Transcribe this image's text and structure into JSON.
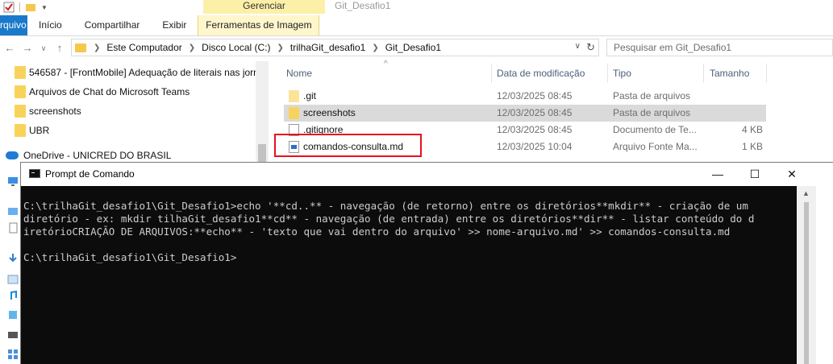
{
  "explorer": {
    "window_title": "Git_Desafio1",
    "contextual_group": "Gerenciar",
    "tabs": [
      "rquivo",
      "Início",
      "Compartilhar",
      "Exibir",
      "Ferramentas de Imagem"
    ],
    "breadcrumb": [
      "Este Computador",
      "Disco Local (C:)",
      "trilhaGit_desafio1",
      "Git_Desafio1"
    ],
    "search_placeholder": "Pesquisar em Git_Desafio1",
    "nav_items": [
      "546587 - [FrontMobile] Adequação de literais nas jorn",
      "Arquivos de Chat do Microsoft Teams",
      "screenshots",
      "UBR"
    ],
    "onedrive_label": "OneDrive - UNICRED DO BRASIL",
    "columns": {
      "name": "Nome",
      "date": "Data de modificação",
      "type": "Tipo",
      "size": "Tamanho"
    },
    "files": [
      {
        "name": ".git",
        "date": "12/03/2025 08:45",
        "type": "Pasta de arquivos",
        "size": "",
        "icon": "folder"
      },
      {
        "name": "screenshots",
        "date": "12/03/2025 08:45",
        "type": "Pasta de arquivos",
        "size": "",
        "icon": "folder",
        "selected": true
      },
      {
        "name": ".gitignore",
        "date": "12/03/2025 08:45",
        "type": "Documento de Te...",
        "size": "4 KB",
        "icon": "document"
      },
      {
        "name": "comandos-consulta.md",
        "date": "12/03/2025 10:04",
        "type": "Arquivo Fonte Ma...",
        "size": "1 KB",
        "icon": "markdown-file"
      }
    ]
  },
  "cmd": {
    "title": "Prompt de Comando",
    "lines": [
      "C:\\trilhaGit_desafio1\\Git_Desafio1>echo '**cd..** - navegação (de retorno) entre os diretórios**mkdir** - criação de um",
      "diretório - ex: mkdir tilhaGit_desafio1**cd** - navegação (de entrada) entre os diretórios**dir** - listar conteúdo do d",
      "iretórioCRIAÇÃO DE ARQUIVOS:**echo** - 'texto que vai dentro do arquivo' >> nome-arquivo.md' >> comandos-consulta.md",
      "",
      "C:\\trilhaGit_desafio1\\Git_Desafio1>"
    ]
  },
  "colors": {
    "highlight_border": "#e8101b",
    "console_bg": "#0c0c0c",
    "console_text": "#cccccc",
    "file_tab": "#1979ca",
    "context_band": "#fcefa8"
  }
}
